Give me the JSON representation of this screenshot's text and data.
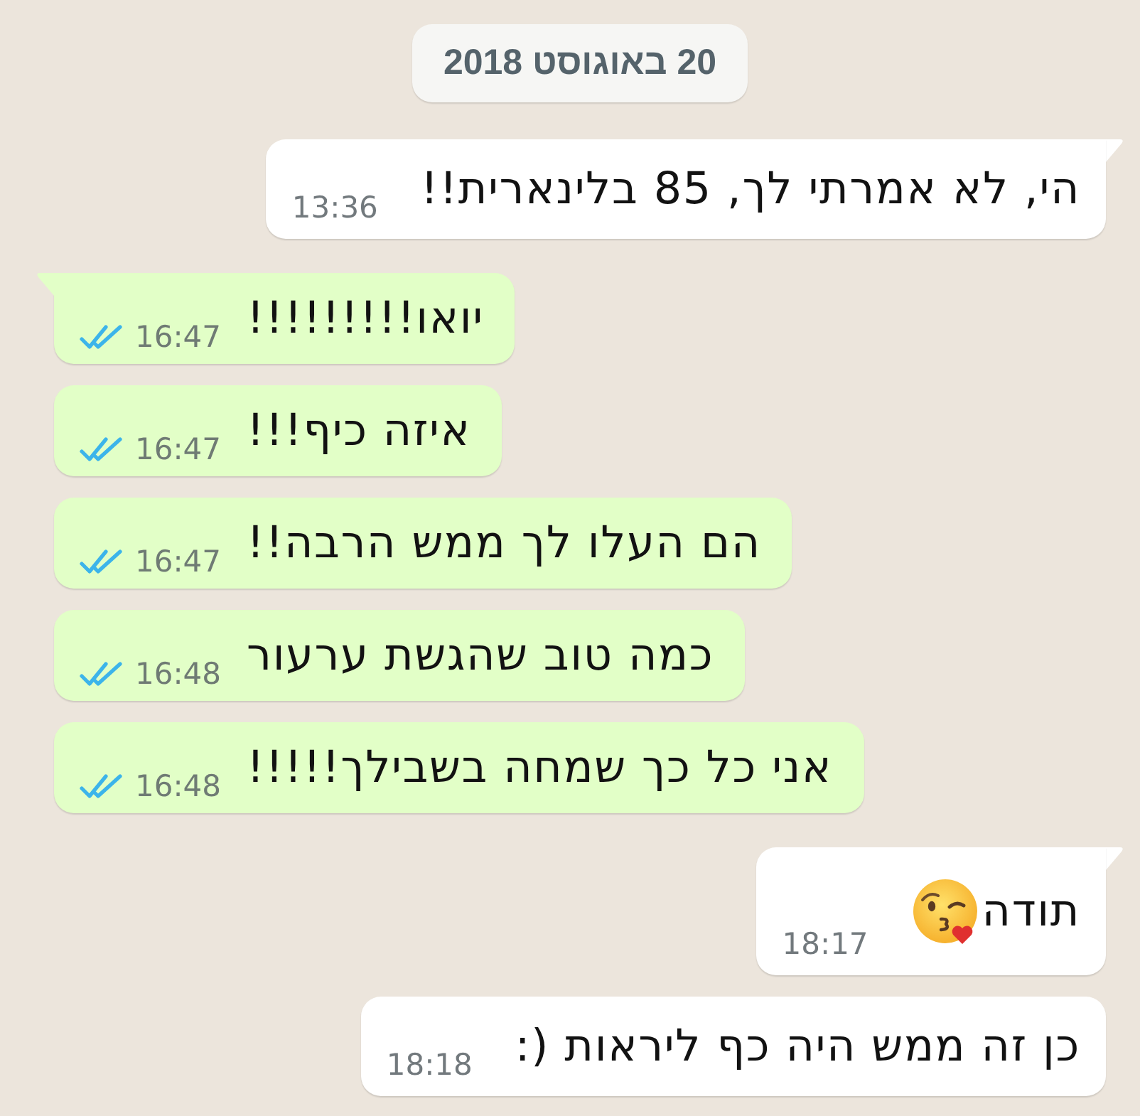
{
  "date_chip": "20 באוגוסט 2018",
  "messages": [
    {
      "kind": "incoming",
      "tail": true,
      "text": "הי, לא אמרתי לך, 85 בלינארית!!",
      "time": "13:36"
    },
    {
      "kind": "outgoing",
      "tail": true,
      "text": "יואו!!!!!!!!!",
      "time": "16:47",
      "read": true
    },
    {
      "kind": "outgoing",
      "tail": false,
      "text": "איזה כיף!!!",
      "time": "16:47",
      "read": true
    },
    {
      "kind": "outgoing",
      "tail": false,
      "text": "הם העלו לך ממש הרבה!!",
      "time": "16:47",
      "read": true
    },
    {
      "kind": "outgoing",
      "tail": false,
      "text": "כמה טוב שהגשת ערעור",
      "time": "16:48",
      "read": true
    },
    {
      "kind": "outgoing",
      "tail": false,
      "text": "אני כל כך שמחה בשבילך!!!!!",
      "time": "16:48",
      "read": true
    },
    {
      "kind": "incoming",
      "tail": true,
      "text": "תודה",
      "emoji": true,
      "time": "18:17"
    },
    {
      "kind": "incoming",
      "tail": false,
      "text": "כן זה ממש היה כף ליראות (:",
      "time": "18:18"
    }
  ]
}
